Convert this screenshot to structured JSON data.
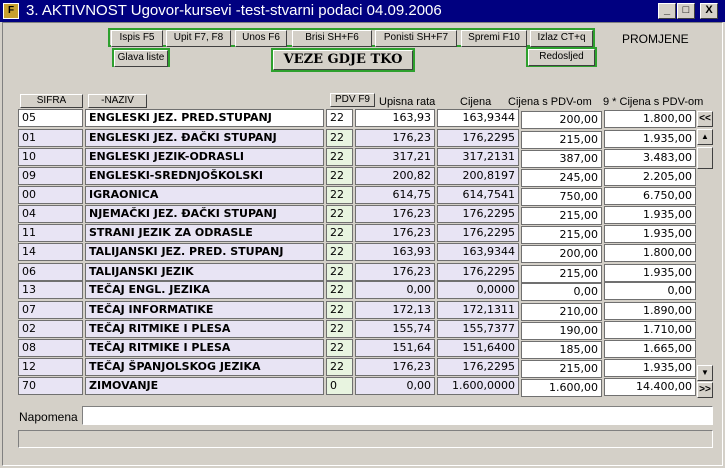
{
  "window": {
    "title": "3. AKTIVNOST    Ugovor-kursevi -test-stvarni podaci 04.09.2006",
    "minimize": "_",
    "maximize": "□",
    "close": "X"
  },
  "toolbar": {
    "ispis": "Ispis F5",
    "upit": "Upit F7, F8",
    "unos": "Unos F6",
    "brisi": "Brisi SH+F6",
    "ponisti": "Ponisti SH+F7",
    "spremi": "Spremi F10",
    "izlaz": "Izlaz CT+q",
    "promjene": "PROMJENE",
    "glava": "Glava liste",
    "veze": "VEZE GDJE TKO",
    "redosljed": "Redosljed"
  },
  "columns": {
    "sifra": "SIFRA",
    "naziv": "-NAZIV",
    "pdv": "PDV F9",
    "rata": "Upisna rata",
    "cijena": "Cijena",
    "cpdv": "Cijena s PDV-om",
    "c9": "9 * Cijena s PDV-om"
  },
  "rows": [
    {
      "sifra": "05",
      "naziv": "ENGLESKI JEZ. PRED.STUPANJ",
      "pdv": "22",
      "rata": "163,93",
      "cijena": "163,9344",
      "cpdv": "200,00",
      "c9": "1.800,00"
    },
    {
      "sifra": "01",
      "naziv": "ENGLESKI JEZ. ĐAČKI STUPANJ",
      "pdv": "22",
      "rata": "176,23",
      "cijena": "176,2295",
      "cpdv": "215,00",
      "c9": "1.935,00"
    },
    {
      "sifra": "10",
      "naziv": "ENGLESKI JEZIK-ODRASLI",
      "pdv": "22",
      "rata": "317,21",
      "cijena": "317,2131",
      "cpdv": "387,00",
      "c9": "3.483,00"
    },
    {
      "sifra": "09",
      "naziv": "ENGLESKI-SREDNJOŠKOLSKI",
      "pdv": "22",
      "rata": "200,82",
      "cijena": "200,8197",
      "cpdv": "245,00",
      "c9": "2.205,00"
    },
    {
      "sifra": "00",
      "naziv": "IGRAONICA",
      "pdv": "22",
      "rata": "614,75",
      "cijena": "614,7541",
      "cpdv": "750,00",
      "c9": "6.750,00"
    },
    {
      "sifra": "04",
      "naziv": "NJEMAČKI JEZ. ĐAČKI STUPANJ",
      "pdv": "22",
      "rata": "176,23",
      "cijena": "176,2295",
      "cpdv": "215,00",
      "c9": "1.935,00"
    },
    {
      "sifra": "11",
      "naziv": "STRANI JEZIK ZA ODRASLE",
      "pdv": "22",
      "rata": "176,23",
      "cijena": "176,2295",
      "cpdv": "215,00",
      "c9": "1.935,00"
    },
    {
      "sifra": "14",
      "naziv": "TALIJANSKI JEZ. PRED. STUPANJ",
      "pdv": "22",
      "rata": "163,93",
      "cijena": "163,9344",
      "cpdv": "200,00",
      "c9": "1.800,00"
    },
    {
      "sifra": "06",
      "naziv": "TALIJANSKI JEZIK",
      "pdv": "22",
      "rata": "176,23",
      "cijena": "176,2295",
      "cpdv": "215,00",
      "c9": "1.935,00"
    },
    {
      "sifra": "13",
      "naziv": "TEČAJ ENGL. JEZIKA",
      "pdv": "22",
      "rata": "0,00",
      "cijena": "0,0000",
      "cpdv": "0,00",
      "c9": "0,00"
    },
    {
      "sifra": "07",
      "naziv": "TEČAJ INFORMATIKE",
      "pdv": "22",
      "rata": "172,13",
      "cijena": "172,1311",
      "cpdv": "210,00",
      "c9": "1.890,00"
    },
    {
      "sifra": "02",
      "naziv": "TEČAJ RITMIKE I PLESA",
      "pdv": "22",
      "rata": "155,74",
      "cijena": "155,7377",
      "cpdv": "190,00",
      "c9": "1.710,00"
    },
    {
      "sifra": "08",
      "naziv": "TEČAJ RITMIKE I PLESA",
      "pdv": "22",
      "rata": "151,64",
      "cijena": "151,6400",
      "cpdv": "185,00",
      "c9": "1.665,00"
    },
    {
      "sifra": "12",
      "naziv": "TEČAJ ŠPANJOLSKOG JEZIKA",
      "pdv": "22",
      "rata": "176,23",
      "cijena": "176,2295",
      "cpdv": "215,00",
      "c9": "1.935,00"
    },
    {
      "sifra": "70",
      "naziv": "ZIMOVANJE",
      "pdv": "0",
      "rata": "0,00",
      "cijena": "1.600,0000",
      "cpdv": "1.600,00",
      "c9": "14.400,00"
    }
  ],
  "nav": {
    "prev": "<<",
    "next": ">>"
  },
  "napomena": {
    "label": "Napomena",
    "value": ""
  }
}
